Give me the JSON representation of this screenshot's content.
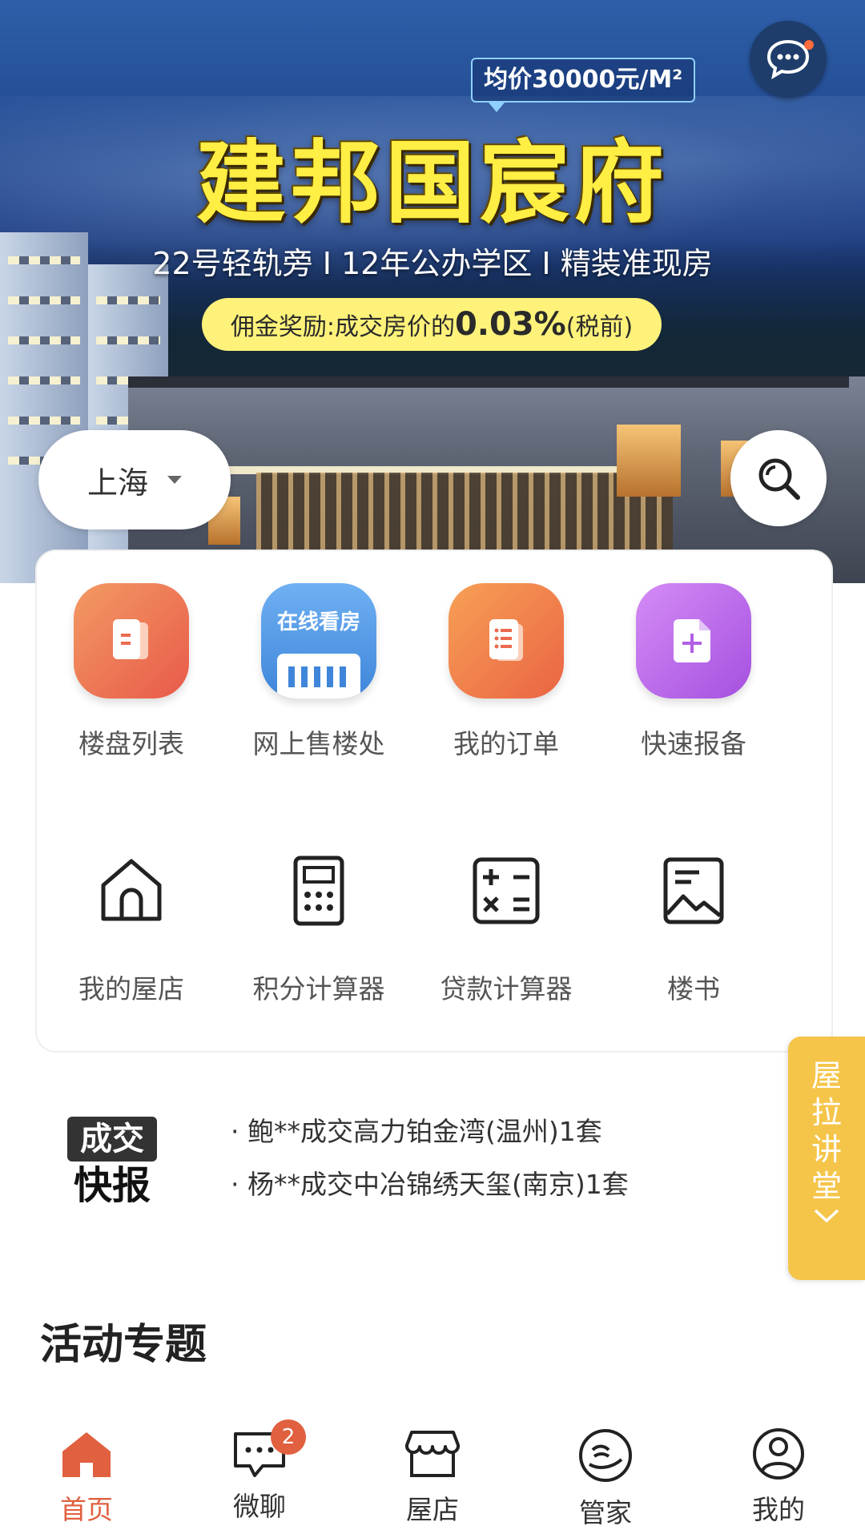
{
  "banner": {
    "price": "均价30000元/M²",
    "title": "建邦国宸府",
    "features": "22号轻轨旁 I 12年公办学区 I 精装准现房",
    "commission_prefix": "佣金奖励:成交房价的",
    "commission_value": "0.03%",
    "commission_suffix": "(税前)"
  },
  "header": {
    "city": "上海"
  },
  "menu": {
    "row1": [
      {
        "label": "楼盘列表",
        "icon": "building-list-icon",
        "color": "#ef6a4f"
      },
      {
        "label": "网上售楼处",
        "icon": "online-viewing-icon",
        "icon_text": "在线看房",
        "color": "#4a90e2"
      },
      {
        "label": "我的订单",
        "icon": "order-list-icon",
        "color": "#f07a46"
      },
      {
        "label": "快速报备",
        "icon": "quick-report-icon",
        "color": "#b25fe6"
      }
    ],
    "row2": [
      {
        "label": "我的屋店",
        "icon": "home-icon"
      },
      {
        "label": "积分计算器",
        "icon": "calculator-icon"
      },
      {
        "label": "贷款计算器",
        "icon": "math-operators-icon"
      },
      {
        "label": "楼书",
        "icon": "picture-icon"
      }
    ]
  },
  "news": {
    "badge_top": "成交",
    "badge_bottom": "快报",
    "items": [
      "· 鲍**成交高力铂金湾(温州)1套",
      "· 杨**成交中冶锦绣天玺(南京)1套"
    ]
  },
  "lecture": {
    "label": "屋拉讲堂"
  },
  "section": {
    "title": "活动专题"
  },
  "bottom_nav": {
    "active_color": "#e0603f",
    "items": [
      {
        "label": "首页",
        "icon": "home-filled-icon",
        "active": true
      },
      {
        "label": "微聊",
        "icon": "chat-icon",
        "badge": "2"
      },
      {
        "label": "屋店",
        "icon": "store-icon"
      },
      {
        "label": "管家",
        "icon": "butler-icon"
      },
      {
        "label": "我的",
        "icon": "profile-icon"
      }
    ]
  }
}
